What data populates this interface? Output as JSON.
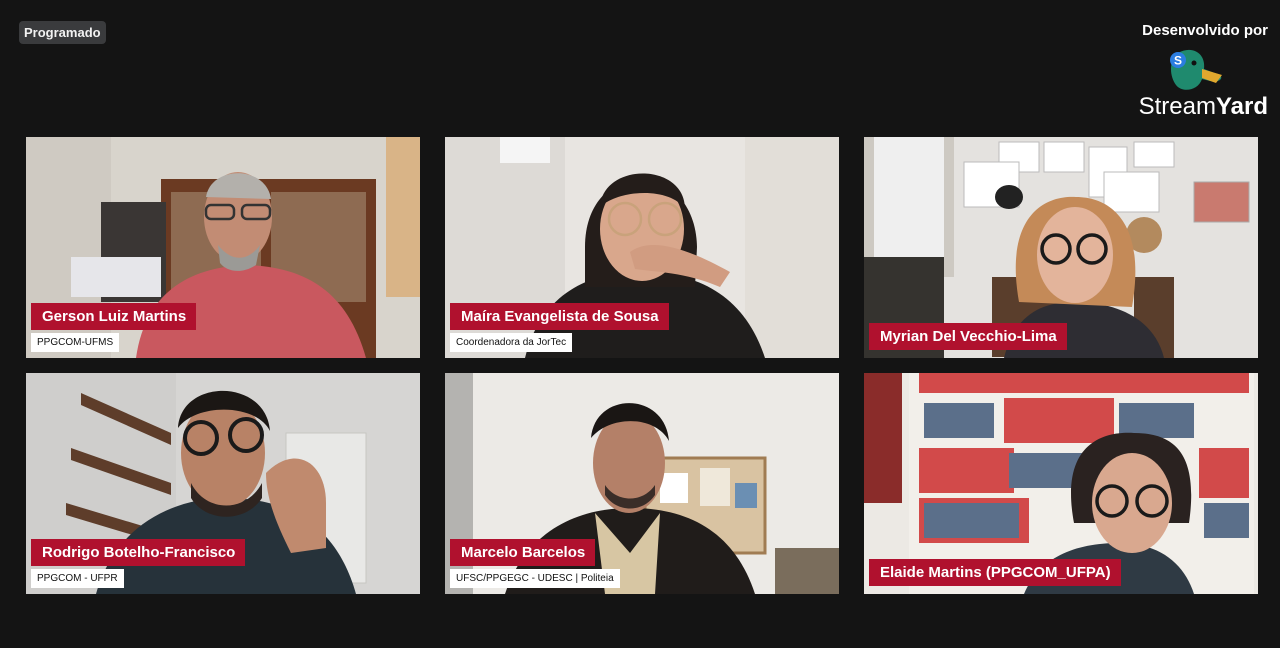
{
  "status_badge": "Programado",
  "branding": {
    "developed_by": "Desenvolvido por",
    "brand_light": "Stream",
    "brand_bold": "Yard",
    "logo_letter": "S"
  },
  "participants": [
    {
      "name": "Gerson Luiz Martins",
      "subtitle": "PPGCOM-UFMS"
    },
    {
      "name": "Maíra Evangelista de Sousa",
      "subtitle": "Coordenadora da JorTec"
    },
    {
      "name": "Myrian Del Vecchio-Lima",
      "subtitle": ""
    },
    {
      "name": "Rodrigo Botelho-Francisco",
      "subtitle": "PPGCOM - UFPR"
    },
    {
      "name": "Marcelo Barcelos",
      "subtitle": "UFSC/PPGEGC - UDESC | Politeia"
    },
    {
      "name": "Elaide Martins (PPGCOM_UFPA)",
      "subtitle": ""
    }
  ],
  "colors": {
    "background": "#141414",
    "nametag": "#b0112e",
    "badge": "#3a3b3d"
  }
}
